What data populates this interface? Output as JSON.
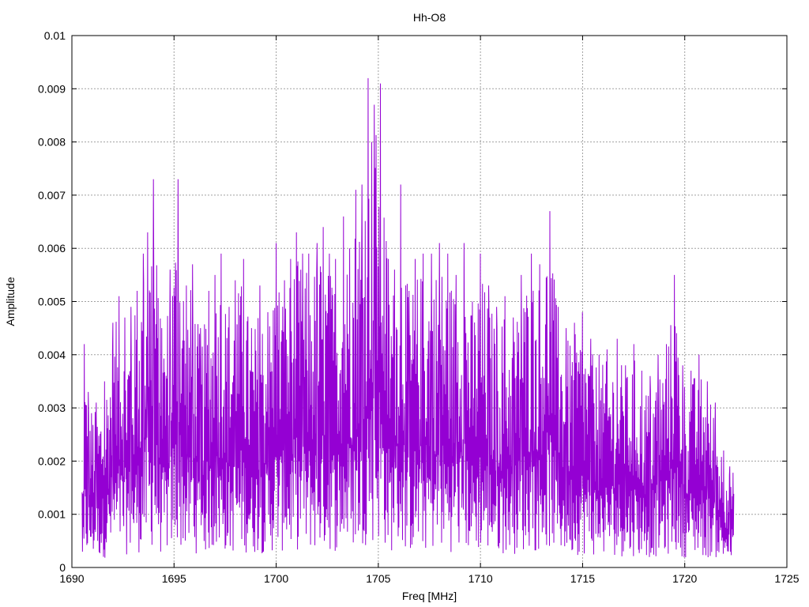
{
  "chart_data": {
    "type": "line",
    "title": "Hh-O8",
    "xlabel": "Freq [MHz]",
    "ylabel": "Amplitude",
    "xlim": [
      1690,
      1725
    ],
    "ylim": [
      0,
      0.01
    ],
    "x_ticks": [
      "1690",
      "1695",
      "1700",
      "1705",
      "1710",
      "1715",
      "1720",
      "1725"
    ],
    "x_tick_values": [
      1690,
      1695,
      1700,
      1705,
      1710,
      1715,
      1720,
      1725
    ],
    "y_ticks": [
      "0",
      "0.001",
      "0.002",
      "0.003",
      "0.004",
      "0.005",
      "0.006",
      "0.007",
      "0.008",
      "0.009",
      "0.01"
    ],
    "y_tick_values": [
      0,
      0.001,
      0.002,
      0.003,
      0.004,
      0.005,
      0.006,
      0.007,
      0.008,
      0.009,
      0.01
    ],
    "grid": true,
    "line_color": "#9400d3",
    "series": [
      {
        "x_start": 1690.5,
        "x_end": 1722.4,
        "peaks": [
          [
            1690.6,
            0.0042
          ],
          [
            1690.8,
            0.0033
          ],
          [
            1691.2,
            0.0031
          ],
          [
            1691.6,
            0.0035
          ],
          [
            1692.0,
            0.0046
          ],
          [
            1692.3,
            0.0051
          ],
          [
            1692.6,
            0.0047
          ],
          [
            1692.9,
            0.0049
          ],
          [
            1693.2,
            0.0052
          ],
          [
            1693.5,
            0.0059
          ],
          [
            1693.7,
            0.0063
          ],
          [
            1694.0,
            0.0073
          ],
          [
            1694.4,
            0.0045
          ],
          [
            1694.8,
            0.0056
          ],
          [
            1695.2,
            0.0073
          ],
          [
            1695.6,
            0.0053
          ],
          [
            1695.9,
            0.0057
          ],
          [
            1696.3,
            0.0045
          ],
          [
            1696.7,
            0.0052
          ],
          [
            1697.0,
            0.0055
          ],
          [
            1697.3,
            0.0059
          ],
          [
            1697.7,
            0.0049
          ],
          [
            1698.0,
            0.0054
          ],
          [
            1698.4,
            0.0058
          ],
          [
            1698.8,
            0.0045
          ],
          [
            1699.2,
            0.0053
          ],
          [
            1699.6,
            0.0048
          ],
          [
            1700.0,
            0.0061
          ],
          [
            1700.4,
            0.0054
          ],
          [
            1700.7,
            0.0058
          ],
          [
            1701.0,
            0.0063
          ],
          [
            1701.3,
            0.0059
          ],
          [
            1701.6,
            0.0059
          ],
          [
            1702.0,
            0.0061
          ],
          [
            1702.3,
            0.0064
          ],
          [
            1702.6,
            0.0059
          ],
          [
            1702.9,
            0.0058
          ],
          [
            1703.3,
            0.0066
          ],
          [
            1703.6,
            0.006
          ],
          [
            1703.9,
            0.0071
          ],
          [
            1704.2,
            0.0072
          ],
          [
            1704.5,
            0.0092
          ],
          [
            1704.8,
            0.0087
          ],
          [
            1705.1,
            0.0091
          ],
          [
            1705.5,
            0.0058
          ],
          [
            1705.8,
            0.0056
          ],
          [
            1706.1,
            0.0072
          ],
          [
            1706.5,
            0.0052
          ],
          [
            1706.8,
            0.0058
          ],
          [
            1707.2,
            0.0059
          ],
          [
            1707.6,
            0.0059
          ],
          [
            1708.0,
            0.0061
          ],
          [
            1708.4,
            0.0059
          ],
          [
            1708.8,
            0.0055
          ],
          [
            1709.2,
            0.0061
          ],
          [
            1709.6,
            0.005
          ],
          [
            1710.0,
            0.0059
          ],
          [
            1710.4,
            0.0053
          ],
          [
            1710.8,
            0.0049
          ],
          [
            1711.2,
            0.0051
          ],
          [
            1711.6,
            0.0047
          ],
          [
            1712.0,
            0.0055
          ],
          [
            1712.5,
            0.0059
          ],
          [
            1712.9,
            0.0057
          ],
          [
            1713.4,
            0.0067
          ],
          [
            1713.8,
            0.0049
          ],
          [
            1714.2,
            0.0045
          ],
          [
            1714.6,
            0.0046
          ],
          [
            1715.0,
            0.0048
          ],
          [
            1715.4,
            0.0043
          ],
          [
            1715.8,
            0.004
          ],
          [
            1716.2,
            0.0041
          ],
          [
            1716.7,
            0.0043
          ],
          [
            1717.1,
            0.0038
          ],
          [
            1717.5,
            0.0042
          ],
          [
            1717.9,
            0.0037
          ],
          [
            1718.3,
            0.0036
          ],
          [
            1718.7,
            0.004
          ],
          [
            1719.1,
            0.0042
          ],
          [
            1719.5,
            0.0055
          ],
          [
            1719.9,
            0.0038
          ],
          [
            1720.3,
            0.0037
          ],
          [
            1720.7,
            0.004
          ],
          [
            1721.1,
            0.0035
          ],
          [
            1721.5,
            0.0031
          ],
          [
            1721.9,
            0.0022
          ],
          [
            1722.2,
            0.0019
          ]
        ]
      }
    ]
  }
}
